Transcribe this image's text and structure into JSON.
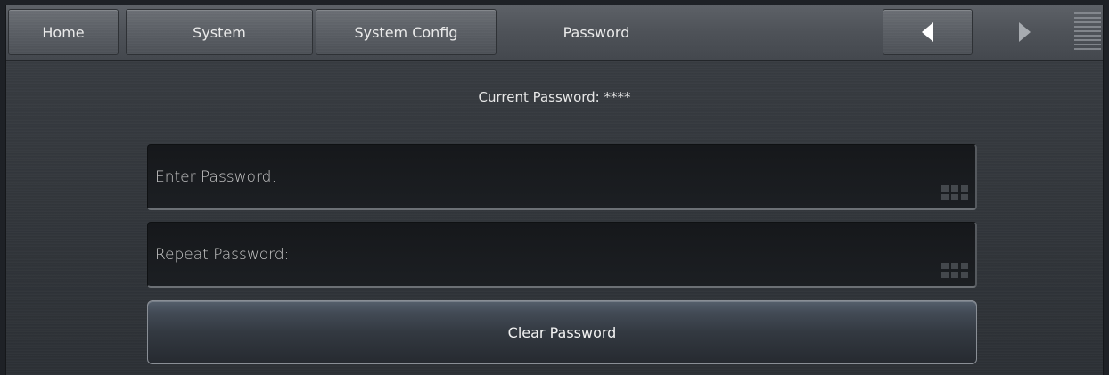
{
  "nav": {
    "tabs": [
      {
        "label": "Home"
      },
      {
        "label": "System"
      },
      {
        "label": "System Config"
      },
      {
        "label": "Password"
      }
    ],
    "back_icon": "triangle-left-icon",
    "forward_icon": "triangle-right-icon",
    "menu_icon": "hamburger-menu-icon"
  },
  "content": {
    "current_password_text": "Current Password: ****",
    "fields": [
      {
        "label": "Enter Password:",
        "value": "",
        "icon": "keypad-icon"
      },
      {
        "label": "Repeat Password:",
        "value": "",
        "icon": "keypad-icon"
      }
    ],
    "clear_button_label": "Clear Password"
  },
  "colors": {
    "background": "#33373c",
    "text": "#e8e8e8",
    "back_arrow": "#ffffff",
    "forward_arrow": "#a7abb0"
  }
}
